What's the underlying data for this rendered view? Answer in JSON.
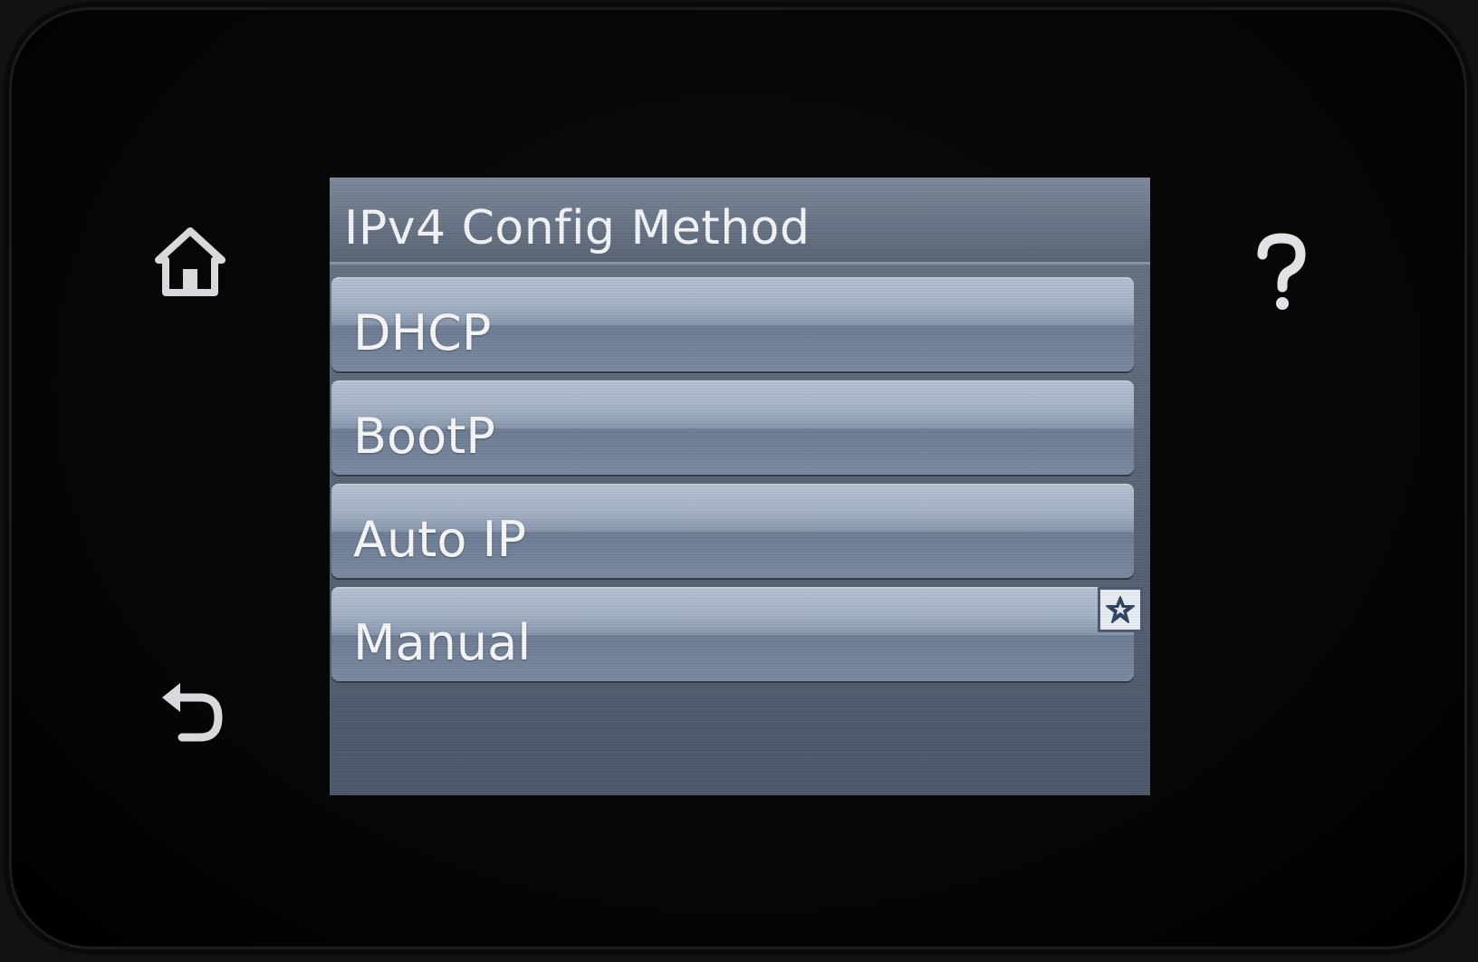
{
  "screen": {
    "title": "IPv4 Config Method"
  },
  "menu": {
    "items": [
      {
        "label": "DHCP"
      },
      {
        "label": "BootP"
      },
      {
        "label": "Auto IP"
      },
      {
        "label": "Manual",
        "selected": true
      }
    ]
  },
  "hardware_buttons": {
    "home": "home-icon",
    "back": "back-arrow-icon",
    "help": "help-question-icon"
  },
  "colors": {
    "screen_bg": "#5a6576",
    "button_light": "#b7c3d4",
    "text": "#f8f9fb"
  }
}
